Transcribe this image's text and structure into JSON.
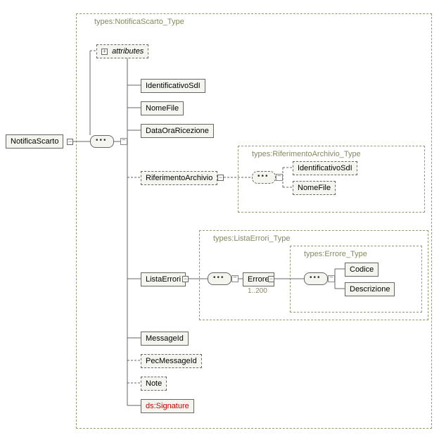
{
  "root": {
    "label": "NotificaScarto"
  },
  "typeMain": {
    "label": "types:NotificaScarto_Type"
  },
  "attributes": {
    "label": "attributes"
  },
  "children": {
    "identificativoSdI": "IdentificativoSdI",
    "nomeFile": "NomeFile",
    "dataOraRicezione": "DataOraRicezione",
    "riferimentoArchivio": "RiferimentoArchivio",
    "listaErrori": "ListaErrori",
    "messageId": "MessageId",
    "pecMessageId": "PecMessageId",
    "note": "Note",
    "signature": "ds:Signature"
  },
  "typeRif": {
    "label": "types:RiferimentoArchivio_Type",
    "identificativoSdI": "IdentificativoSdI",
    "nomeFile": "NomeFile"
  },
  "typeLista": {
    "label": "types:ListaErrori_Type",
    "errore": "Errore",
    "erroreOcc": "1..200"
  },
  "typeErrore": {
    "label": "types:Errore_Type",
    "codice": "Codice",
    "descrizione": "Descrizione"
  }
}
